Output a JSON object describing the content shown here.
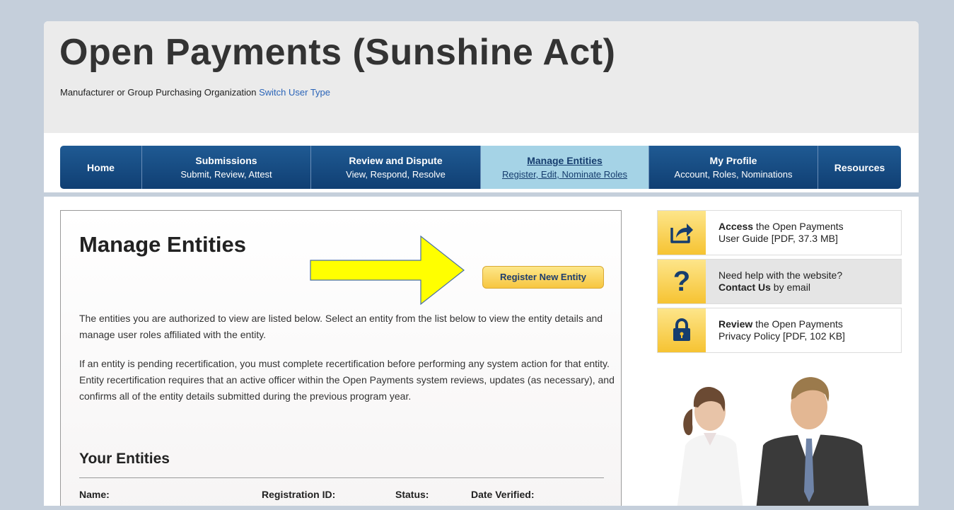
{
  "header": {
    "title": "Open Payments (Sunshine Act)",
    "user_type_label": "Manufacturer or Group Purchasing Organization",
    "switch_link": "Switch User Type"
  },
  "nav": {
    "items": [
      {
        "title": "Home",
        "subtitle": ""
      },
      {
        "title": "Submissions",
        "subtitle": "Submit, Review, Attest"
      },
      {
        "title": "Review and Dispute",
        "subtitle": "View, Respond, Resolve"
      },
      {
        "title": "Manage Entities",
        "subtitle": "Register, Edit, Nominate Roles"
      },
      {
        "title": "My Profile",
        "subtitle": "Account, Roles, Nominations"
      },
      {
        "title": "Resources",
        "subtitle": ""
      }
    ]
  },
  "main": {
    "title": "Manage Entities",
    "register_button": "Register New Entity",
    "para1": "The entities you are authorized to view are listed below. Select an entity from the list below to view the entity details and manage user roles affiliated with the entity.",
    "para2": "If an entity is pending recertification, you must complete recertification before performing any system action for that entity. Entity recertification requires that an active officer within the Open Payments system reviews, updates (as necessary), and confirms all of the entity details submitted during the previous program year.",
    "your_entities": "Your Entities",
    "columns": [
      "Name:",
      "Registration ID:",
      "Status:",
      "Date Verified:"
    ]
  },
  "sidebar": {
    "cards": [
      {
        "bold": "Access",
        "text1": " the Open Payments",
        "text2": "User Guide [PDF, 37.3 MB]",
        "icon": "share-arrow-icon"
      },
      {
        "bold": "Contact Us",
        "text1": "Need help with the website?",
        "text2": " by email",
        "icon": "question-mark-icon"
      },
      {
        "bold": "Review",
        "text1": " the Open Payments",
        "text2": "Privacy Policy [PDF, 102 KB]",
        "icon": "lock-icon"
      }
    ]
  },
  "colors": {
    "nav_bg": "#134a82",
    "nav_active": "#a5d3e6",
    "button_yellow": "#f7c640",
    "annotation_arrow": "#ffff00"
  }
}
